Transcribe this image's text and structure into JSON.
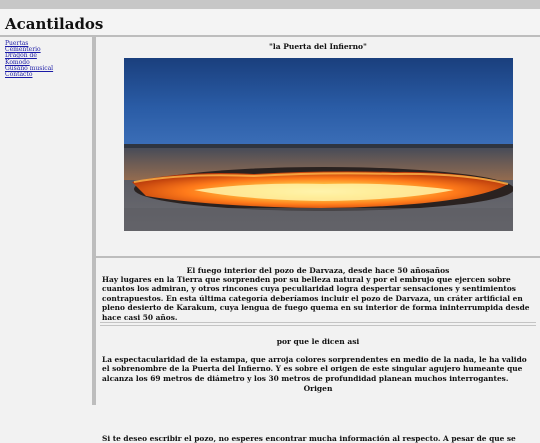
{
  "site": {
    "title": "Acantilados"
  },
  "nav": {
    "items": [
      {
        "label": "Puertas"
      },
      {
        "label": "Cementerio"
      },
      {
        "label": "Dragon de"
      },
      {
        "label": "Komodo"
      },
      {
        "label": "Gusano musical"
      },
      {
        "label": "Contacto"
      }
    ]
  },
  "feature": {
    "title": "\"la Puerta del Infierno\"",
    "image_alt": "Cráter de Darvaza ardiendo de noche"
  },
  "article1": {
    "title": "El fuego interior del pozo de Darvaza, desde hace 50 añosaños",
    "body": "Hay lugares en la Tierra que sorprenden por su belleza natural y por el embrujo que ejercen sobre cuantos los admiran, y otros rincones cuya peculiaridad logra despertar sensaciones y sentimientos contrapuestos. En esta última categoría deberíamos incluir el pozo de Darvaza, un cráter artificial en pleno desierto de Karakum, cuya lengua de fuego quema en su interior de forma ininterrumpida desde hace casi 50 años."
  },
  "article2": {
    "title": "por que le dicen asi",
    "body": "La espectacularidad de la estampa, que arroja colores sorprendentes en medio de la nada, le ha valido el sobrenombre de la Puerta del Infierno. Y es sobre el origen de este singular agujero humeante que alcanza los 69 metros de diámetro y los 30 metros de profundidad planean muchos interrogantes.",
    "subheading": "Origen",
    "next_line": "Si te deseo escribir el pozo, no esperes encontrar mucha información al respecto. A pesar de que se"
  },
  "colors": {
    "page_background": "#f2f2f2",
    "border_gray": "#bdbdbd",
    "link": "#1a1aa6",
    "fire": "#ff7a1a",
    "sky": "#1e4a8a"
  }
}
